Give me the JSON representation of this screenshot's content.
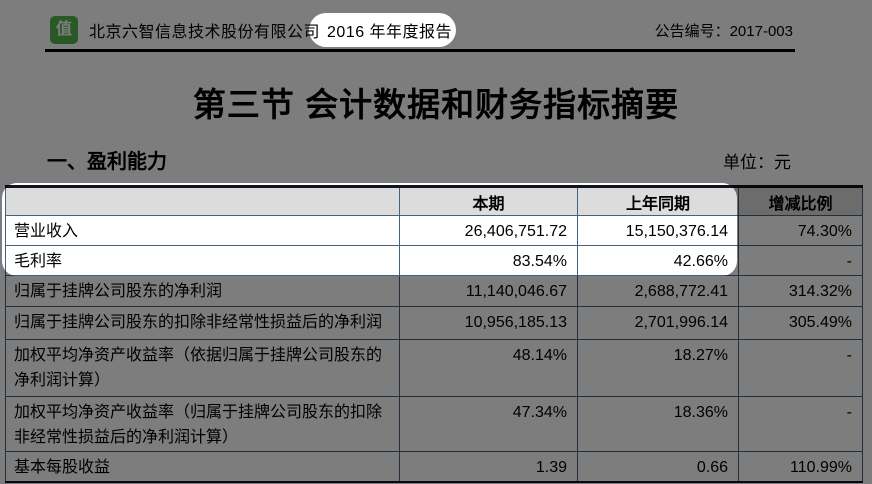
{
  "header": {
    "logo_glyph": "值",
    "company_name": "北京六智信息技术股份有限公司",
    "report_period": "2016 年年度报告",
    "announcement_no": "公告编号：2017-003"
  },
  "page": {
    "title": "第三节  会计数据和财务指标摘要"
  },
  "section": {
    "heading": "一、盈利能力",
    "unit_label": "单位：元"
  },
  "table": {
    "headers": [
      "",
      "本期",
      "上年同期",
      "增减比例"
    ],
    "rows": [
      {
        "label": "营业收入",
        "current": "26,406,751.72",
        "prior": "15,150,376.14",
        "change": "74.30%"
      },
      {
        "label": "毛利率",
        "current": "83.54%",
        "prior": "42.66%",
        "change": "-"
      },
      {
        "label": "归属于挂牌公司股东的净利润",
        "current": "11,140,046.67",
        "prior": "2,688,772.41",
        "change": "314.32%"
      },
      {
        "label": "归属于挂牌公司股东的扣除非经常性损益后的净利润",
        "current": "10,956,185.13",
        "prior": "2,701,996.14",
        "change": "305.49%"
      },
      {
        "label": "加权平均净资产收益率（依据归属于挂牌公司股东的净利润计算）",
        "current": "48.14%",
        "prior": "18.27%",
        "change": "-"
      },
      {
        "label": "加权平均净资产收益率（归属于挂牌公司股东的扣除非经常性损益后的净利润计算）",
        "current": "47.34%",
        "prior": "18.36%",
        "change": "-"
      },
      {
        "label": "基本每股收益",
        "current": "1.39",
        "prior": "0.66",
        "change": "110.99%"
      }
    ]
  },
  "colors": {
    "logo_green": "#55b24f",
    "table_border_blue": "#46617f",
    "header_cell_gray": "#dcdcdc",
    "dim_overlay": "rgba(0,0,0,0.51)"
  }
}
